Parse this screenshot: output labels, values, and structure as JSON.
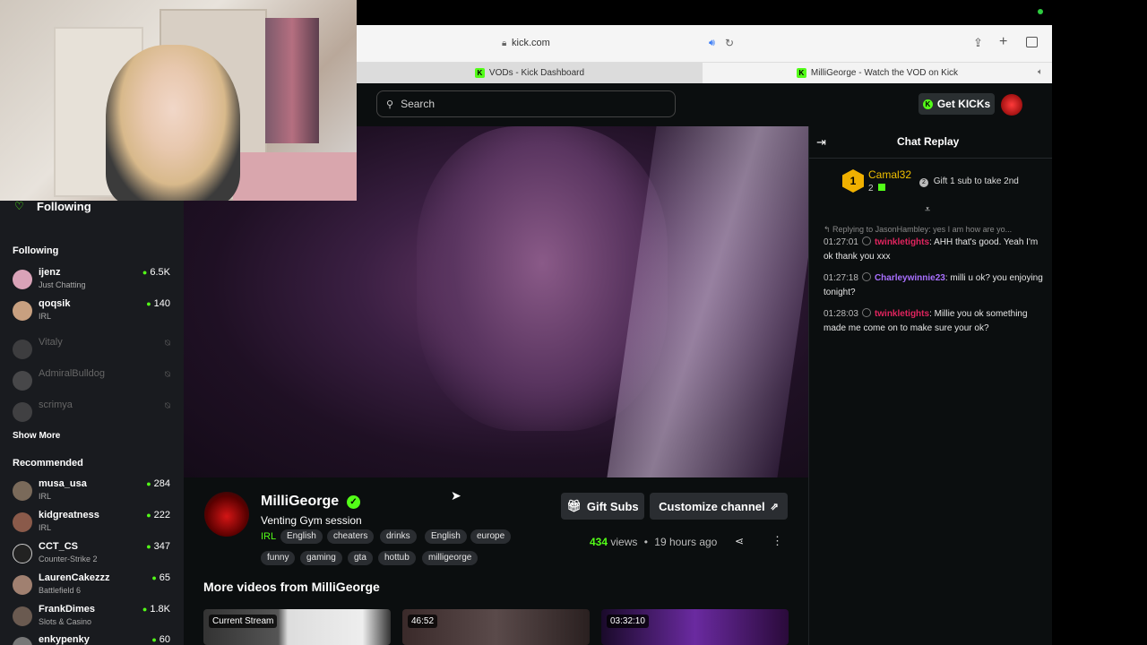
{
  "browser": {
    "url": "kick.com",
    "tabs": [
      {
        "label": "VODs - Kick Dashboard"
      },
      {
        "label": "MilliGeorge - Watch the VOD on Kick"
      }
    ]
  },
  "header": {
    "search_placeholder": "Search",
    "get_kicks_label": "Get KICKs"
  },
  "sidebar": {
    "following_title": "Following",
    "following_heading": "Following",
    "following": [
      {
        "name": "ijenz",
        "category": "Just Chatting",
        "viewers": "6.5K",
        "online": true
      },
      {
        "name": "qoqsik",
        "category": "IRL",
        "viewers": "140",
        "online": true
      },
      {
        "name": "Vitaly",
        "online": false
      },
      {
        "name": "AdmiralBulldog",
        "online": false
      },
      {
        "name": "scrimya",
        "online": false
      }
    ],
    "show_more": "Show More",
    "recommended_heading": "Recommended",
    "recommended": [
      {
        "name": "musa_usa",
        "category": "IRL",
        "viewers": "284"
      },
      {
        "name": "kidgreatness",
        "category": "IRL",
        "viewers": "222"
      },
      {
        "name": "CCT_CS",
        "category": "Counter-Strike 2",
        "viewers": "347"
      },
      {
        "name": "LaurenCakezzz",
        "category": "Battlefield 6",
        "viewers": "65"
      },
      {
        "name": "FrankDimes",
        "category": "Slots & Casino",
        "viewers": "1.8K"
      },
      {
        "name": "enkypenky",
        "category": "",
        "viewers": "60"
      }
    ]
  },
  "channel": {
    "name": "MilliGeorge",
    "title": "Venting Gym session",
    "category": "IRL",
    "tags": [
      "English",
      "cheaters",
      "drinks",
      "English",
      "europe",
      "funny",
      "gaming",
      "gta",
      "hottub",
      "milligeorge"
    ],
    "gift_subs_label": "Gift Subs",
    "customize_label": "Customize channel",
    "views_count": "434",
    "views_label": "views",
    "separator": "•",
    "age": "19 hours ago",
    "more_videos_heading": "More videos from MilliGeorge",
    "thumbnails": [
      {
        "label": "Current Stream"
      },
      {
        "label": "46:52"
      },
      {
        "label": "03:32:10"
      }
    ]
  },
  "chat": {
    "title": "Chat Replay",
    "top_gifter": {
      "rank": "1",
      "name": "Camal32",
      "count": "2"
    },
    "gift_hint": "Gift 1 sub to take 2nd",
    "reply_to": "Replying to JasonHambley: yes I am how are yo...",
    "messages": [
      {
        "time": "01:27:01",
        "user": "twinkletights",
        "text": ": AHH that's good. Yeah I'm ok thank you xxx"
      },
      {
        "time": "01:27:18",
        "user": "Charleywinnie23",
        "text": ": milli u ok? you enjoying tonight?"
      },
      {
        "time": "01:28:03",
        "user": "twinkletights",
        "text": ": Millie you ok something made me come on to make sure your ok?"
      }
    ]
  },
  "colors": {
    "kick_green": "#53fc18",
    "bg": "#0b0e0f",
    "sidebar_bg": "#191b1f"
  }
}
